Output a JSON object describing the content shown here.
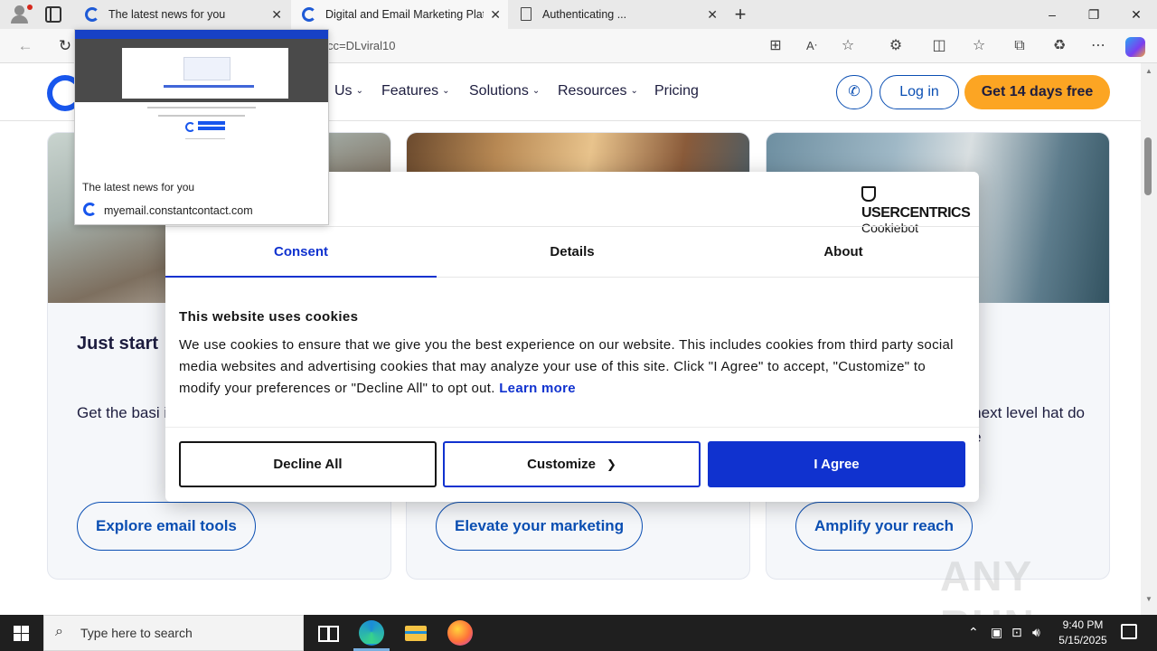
{
  "browser": {
    "tabs": [
      {
        "title": "The latest news for you",
        "active": false
      },
      {
        "title": "Digital and Email Marketing Platf",
        "active": true
      },
      {
        "title": "Authenticating ...",
        "active": false
      }
    ],
    "url_visible": "cc=DLviral10",
    "window_controls": {
      "minimize": "–",
      "maximize": "❐",
      "close": "✕"
    }
  },
  "tab_preview": {
    "title": "The latest news for you",
    "domain": "myemail.constantcontact.com"
  },
  "site": {
    "nav": [
      {
        "label": "Us",
        "has_caret": true
      },
      {
        "label": "Features",
        "has_caret": true
      },
      {
        "label": "Solutions",
        "has_caret": true
      },
      {
        "label": "Resources",
        "has_caret": true
      },
      {
        "label": "Pricing",
        "has_caret": false
      }
    ],
    "caret": "⌄",
    "login": "Log in",
    "trial": "Get 14 days free",
    "brand_color": "#1856ed",
    "accent_color": "#fca523",
    "cards": [
      {
        "heading": "Just start",
        "body": "Get the basi into email co clicks.",
        "cta": "Explore email tools"
      },
      {
        "heading": "",
        "body": "",
        "cta": "Elevate your marketing"
      },
      {
        "heading": "",
        "body": "e next level hat do the",
        "cta": "Amplify your reach"
      }
    ],
    "watermark": "ANY RUN"
  },
  "cookie": {
    "brand_line1": "USERCENTRICS",
    "brand_line2": "Cookiebot",
    "tabs": [
      "Consent",
      "Details",
      "About"
    ],
    "heading": "This website uses cookies",
    "body": "We use cookies to ensure that we give you the best experience on our website. This includes cookies from third party social media websites and advertising cookies that may analyze your use of this site. Click \"I Agree\" to accept, \"Customize\" to modify your preferences or \"Decline All\" to opt out.",
    "learn_more": "Learn more",
    "buttons": {
      "decline": "Decline All",
      "customize": "Customize",
      "agree": "I Agree"
    },
    "accent_color": "#1032cf"
  },
  "taskbar": {
    "search_placeholder": "Type here to search",
    "time": "9:40 PM",
    "date": "5/15/2025"
  }
}
